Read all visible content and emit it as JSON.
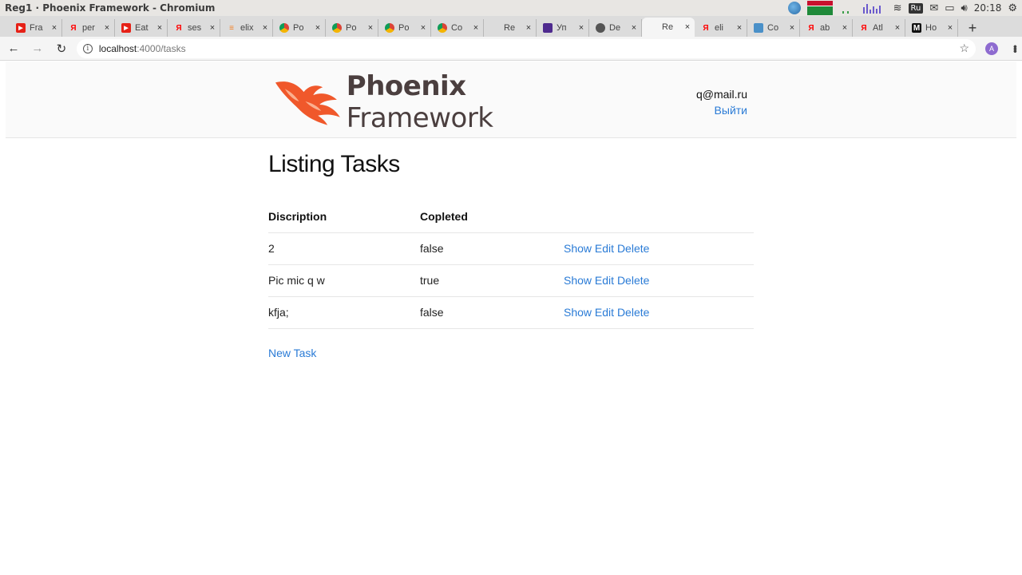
{
  "os": {
    "window_title": "Reg1 · Phoenix Framework - Chromium",
    "keyboard_layout": "Ru",
    "clock": "20:18"
  },
  "tabs": [
    {
      "favicon": "youtube-icon",
      "color": "#e62117",
      "label": "Fra"
    },
    {
      "favicon": "yandex-icon",
      "color": "#ff0000",
      "label": "per"
    },
    {
      "favicon": "youtube-icon",
      "color": "#e62117",
      "label": "Eat"
    },
    {
      "favicon": "yandex-icon",
      "color": "#ff0000",
      "label": "ses"
    },
    {
      "favicon": "stackoverflow-icon",
      "color": "#f48024",
      "label": "elix"
    },
    {
      "favicon": "chrome-icon",
      "color": "#4caf50",
      "label": "Po"
    },
    {
      "favicon": "chrome-icon",
      "color": "#4caf50",
      "label": "Po"
    },
    {
      "favicon": "chrome-icon",
      "color": "#4caf50",
      "label": "Po"
    },
    {
      "favicon": "chrome-icon",
      "color": "#4caf50",
      "label": "Co"
    },
    {
      "favicon": "blank-icon",
      "color": "#dcdcdc",
      "label": "Re"
    },
    {
      "favicon": "elixir-icon",
      "color": "#4e2a8e",
      "label": "Уп"
    },
    {
      "favicon": "globe-icon",
      "color": "#555555",
      "label": "De"
    },
    {
      "favicon": "blank-icon",
      "color": "#f5f5f5",
      "label": "Re",
      "active": true
    },
    {
      "favicon": "yandex-icon",
      "color": "#ff0000",
      "label": "eli"
    },
    {
      "favicon": "puzzle-icon",
      "color": "#4a90c8",
      "label": "Co"
    },
    {
      "favicon": "yandex-icon",
      "color": "#ff0000",
      "label": "ab"
    },
    {
      "favicon": "yandex-icon",
      "color": "#ff0000",
      "label": "Atl"
    },
    {
      "favicon": "medium-icon",
      "color": "#111111",
      "label": "Ho"
    }
  ],
  "toolbar": {
    "url_host": "localhost",
    "url_path": ":4000/tasks",
    "profile_initial": "A"
  },
  "header": {
    "logo_bold": "Phoenix",
    "logo_light": " Framework",
    "user_email": "q@mail.ru",
    "logout_label": "Выйти",
    "brand_color": "#f0582b"
  },
  "main": {
    "title": "Listing Tasks",
    "columns": [
      "Discription",
      "Copleted"
    ],
    "rows": [
      {
        "description": "2",
        "completed": "false"
      },
      {
        "description": "Pic mic q w",
        "completed": "true"
      },
      {
        "description": "kfja;",
        "completed": "false"
      }
    ],
    "actions": {
      "show": "Show",
      "edit": "Edit",
      "delete": "Delete"
    },
    "new_task_label": "New Task",
    "link_color": "#2a7bd6"
  }
}
